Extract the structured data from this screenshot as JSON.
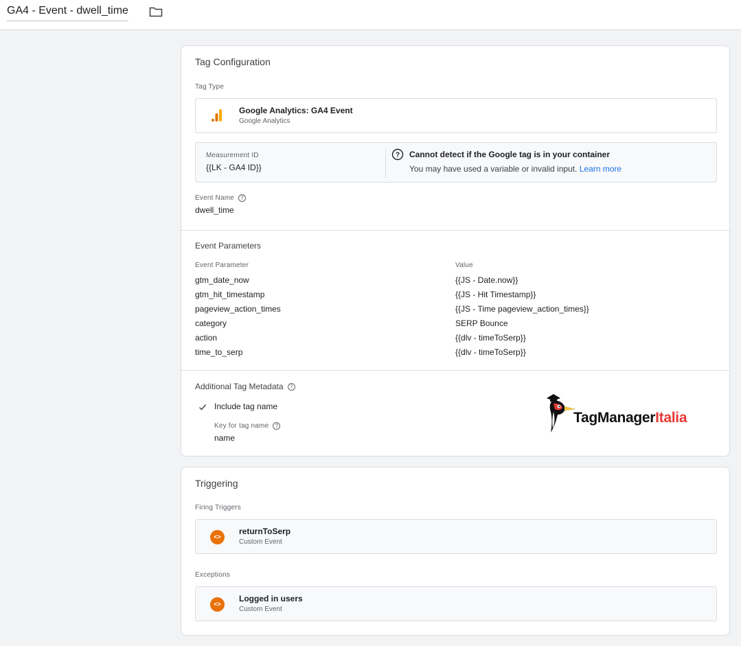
{
  "header": {
    "title": "GA4 - Event - dwell_time",
    "folder_icon": "folder-icon"
  },
  "config": {
    "title": "Tag Configuration",
    "tag_type_label": "Tag Type",
    "tag_type": {
      "name": "Google Analytics: GA4 Event",
      "sub": "Google Analytics",
      "icon": "google-analytics-icon"
    },
    "measurement": {
      "label": "Measurement ID",
      "value": "{{LK - GA4 ID}}"
    },
    "warning": {
      "title": "Cannot detect if the Google tag is in your container",
      "body": "You may have used a variable or invalid input.",
      "link": "Learn more"
    },
    "event_name": {
      "label": "Event Name",
      "value": "dwell_time"
    },
    "event_params": {
      "title": "Event Parameters",
      "col_param": "Event Parameter",
      "col_value": "Value",
      "rows": [
        {
          "param": "gtm_date_now",
          "value": "{{JS - Date.now}}"
        },
        {
          "param": "gtm_hit_timestamp",
          "value": "{{JS - Hit Timestamp}}"
        },
        {
          "param": "pageview_action_times",
          "value": "{{JS - Time pageview_action_times}}"
        },
        {
          "param": "category",
          "value": "SERP Bounce"
        },
        {
          "param": "action",
          "value": "{{dlv - timeToSerp}}"
        },
        {
          "param": "time_to_serp",
          "value": "{{dlv - timeToSerp}}"
        }
      ]
    },
    "metadata": {
      "title": "Additional Tag Metadata",
      "include_label": "Include tag name",
      "key_label": "Key for tag name",
      "key_value": "name"
    }
  },
  "triggering": {
    "title": "Triggering",
    "firing_label": "Firing Triggers",
    "firing": {
      "name": "returnToSerp",
      "sub": "Custom Event"
    },
    "exceptions_label": "Exceptions",
    "exception": {
      "name": "Logged in users",
      "sub": "Custom Event"
    }
  },
  "logo": {
    "part1": "TagManager",
    "part2": "Italia",
    "icon": "woodpecker-mascot-icon"
  },
  "colors": {
    "accent_blue": "#1a73e8",
    "trigger_orange": "#e8710a",
    "ga_orange": "#f9ab00",
    "logo_red": "#e53935"
  }
}
